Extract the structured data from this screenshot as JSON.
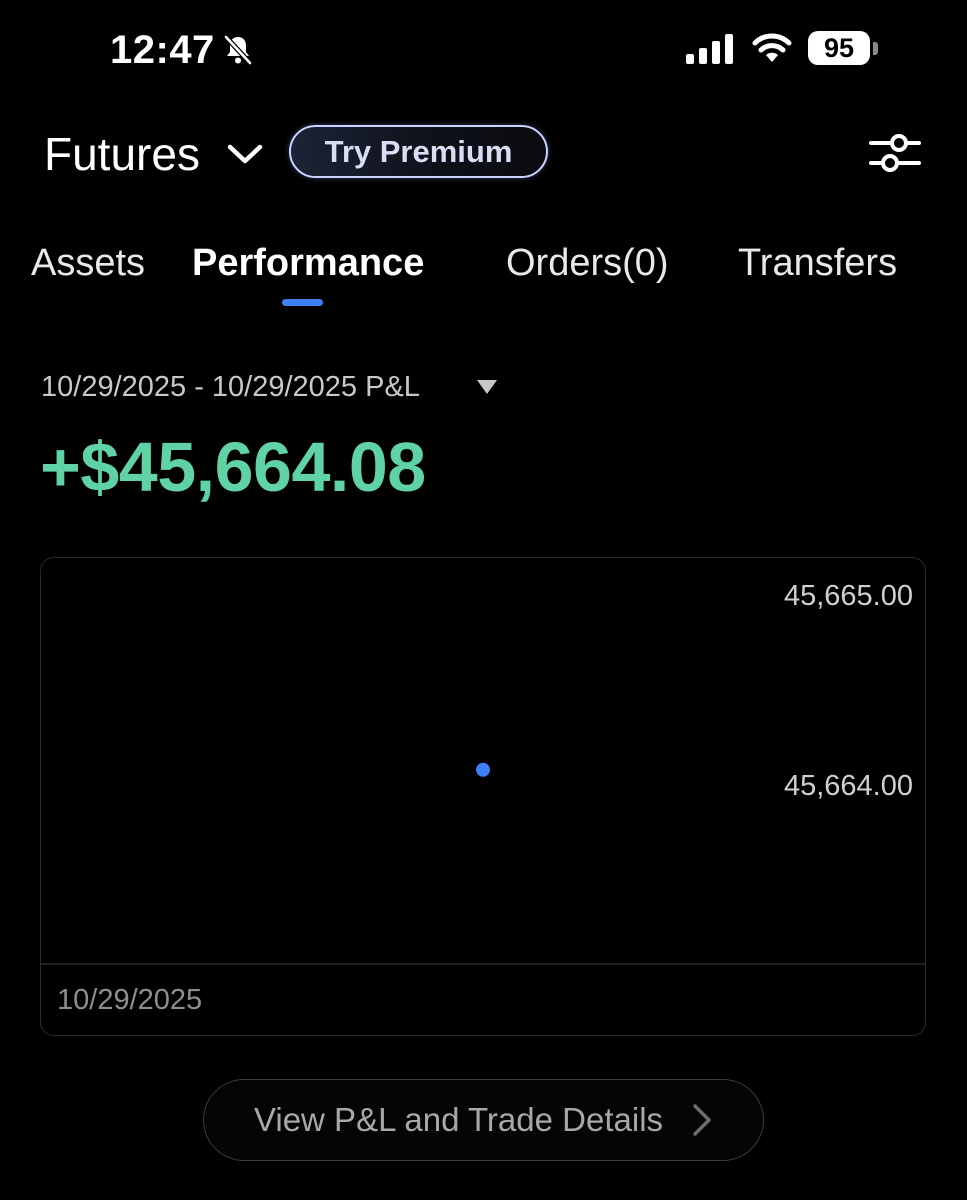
{
  "status_bar": {
    "time": "12:47",
    "battery": "95",
    "icons": [
      "bell-slash-icon",
      "cellular-signal-icon",
      "wifi-icon",
      "battery-icon"
    ]
  },
  "header": {
    "title": "Futures",
    "premium_label": "Try Premium",
    "icons": [
      "chevron-down-icon",
      "filter-sliders-icon"
    ]
  },
  "tabs": [
    {
      "label": "Assets",
      "active": false
    },
    {
      "label": "Performance",
      "active": true
    },
    {
      "label": "Orders(0)",
      "active": false
    },
    {
      "label": "Transfers",
      "active": false
    }
  ],
  "pnl": {
    "range_label": "10/29/2025 - 10/29/2025 P&L",
    "value": "+$45,664.08"
  },
  "chart_data": {
    "type": "scatter",
    "x": [
      "10/29/2025"
    ],
    "y_ticks": [
      "45,665.00",
      "45,664.00"
    ],
    "ylim": [
      45663.0,
      45665.2
    ],
    "series": [
      {
        "x": [
          "10/29/2025"
        ],
        "values": [
          45664.08
        ]
      }
    ],
    "xlabel": "",
    "ylabel": "",
    "grid": false
  },
  "footer": {
    "details_label": "View P&L and Trade Details"
  },
  "colors": {
    "background": "#000000",
    "positive": "#5fd3a5",
    "accent": "#3f7ff6",
    "muted": "#c8c8c8"
  }
}
